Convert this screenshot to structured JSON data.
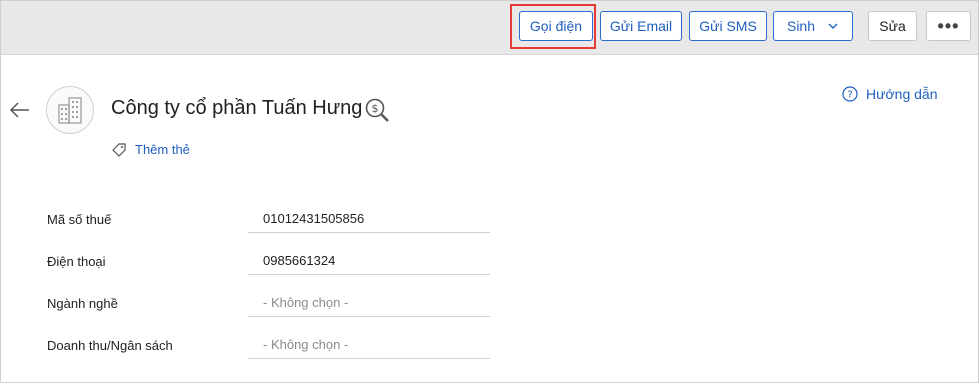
{
  "toolbar": {
    "call_label": "Gọi điện",
    "email_label": "Gửi Email",
    "sms_label": "Gửi SMS",
    "generate_label": "Sinh",
    "edit_label": "Sửa",
    "more_label": "•••"
  },
  "header": {
    "title": "Công ty cổ phần Tuấn Hưng",
    "add_tag_label": "Thêm thẻ",
    "help_label": "Hướng dẫn"
  },
  "fields": [
    {
      "label": "Mã số thuế",
      "value": "01012431505856"
    },
    {
      "label": "Điện thoại",
      "value": "0985661324"
    },
    {
      "label": "Ngành nghề",
      "value": "- Không chọn -"
    },
    {
      "label": "Doanh thu/Ngân sách",
      "value": "- Không chọn -"
    }
  ],
  "colors": {
    "accent": "#1f5fbf",
    "highlight": "#e53935",
    "toolbar_bg": "#e8e8e8"
  },
  "icons": [
    "back-arrow-icon",
    "company-building-icon",
    "dollar-search-icon",
    "tag-icon",
    "help-circle-icon",
    "chevron-down-icon"
  ]
}
